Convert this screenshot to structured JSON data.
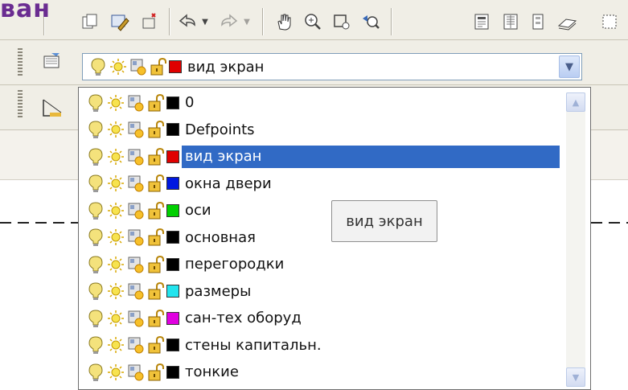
{
  "page_title_fragment": "ван",
  "current_layer": {
    "name": "вид экран",
    "color": "#e00000"
  },
  "layers": [
    {
      "name": "0",
      "color": "#000000"
    },
    {
      "name": "Defpoints",
      "color": "#000000"
    },
    {
      "name": "вид экран",
      "color": "#e00000"
    },
    {
      "name": "окна двери",
      "color": "#0018e0"
    },
    {
      "name": "оси",
      "color": "#00d000"
    },
    {
      "name": "основная",
      "color": "#000000"
    },
    {
      "name": "перегородки",
      "color": "#000000"
    },
    {
      "name": "размеры",
      "color": "#22e4ee"
    },
    {
      "name": "сан-тех оборуд",
      "color": "#e000e0"
    },
    {
      "name": "стены капитальн.",
      "color": "#000000"
    },
    {
      "name": "тонкие",
      "color": "#000000"
    }
  ],
  "selected_index": 2,
  "tooltip": "вид экран",
  "icons": [
    "bulb-icon",
    "sun-icon",
    "viewport-freeze-icon",
    "unlock-icon"
  ],
  "colors": {
    "selection": "#316ac5",
    "title": "#6a2c91"
  }
}
